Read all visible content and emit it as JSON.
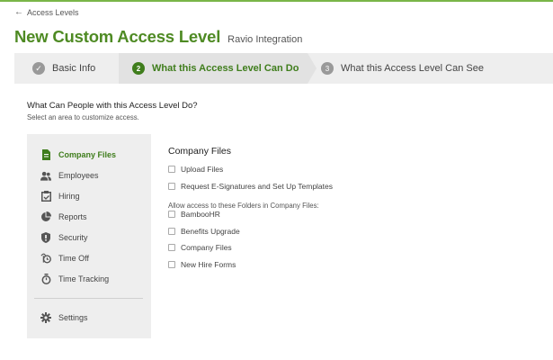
{
  "nav": {
    "back_label": "Access Levels"
  },
  "header": {
    "title": "New Custom Access Level",
    "subtitle": "Ravio Integration"
  },
  "steps": [
    {
      "number": "1",
      "label": "Basic Info",
      "state": "complete",
      "check": "✓"
    },
    {
      "number": "2",
      "label": "What this Access Level Can Do",
      "state": "active"
    },
    {
      "number": "3",
      "label": "What this Access Level Can See",
      "state": "upcoming"
    }
  ],
  "section": {
    "title": "What Can People with this Access Level Do?",
    "subtitle": "Select an area to customize access."
  },
  "sidebar": {
    "items": [
      {
        "label": "Company Files",
        "icon": "file-icon",
        "active": true
      },
      {
        "label": "Employees",
        "icon": "people-icon"
      },
      {
        "label": "Hiring",
        "icon": "clipboard-icon"
      },
      {
        "label": "Reports",
        "icon": "pie-chart-icon"
      },
      {
        "label": "Security",
        "icon": "shield-icon"
      },
      {
        "label": "Time Off",
        "icon": "time-off-icon"
      },
      {
        "label": "Time Tracking",
        "icon": "stopwatch-icon"
      }
    ],
    "settings": {
      "label": "Settings",
      "icon": "gear-icon"
    }
  },
  "panel": {
    "title": "Company Files",
    "options": [
      {
        "label": "Upload Files",
        "checked": false
      },
      {
        "label": "Request E-Signatures and Set Up Templates",
        "checked": false
      }
    ],
    "folders_label": "Allow access to these Folders in Company Files:",
    "folders": [
      {
        "label": "BambooHR",
        "checked": false
      },
      {
        "label": "Benefits Upgrade",
        "checked": false
      },
      {
        "label": "Company Files",
        "checked": false
      },
      {
        "label": "New Hire Forms",
        "checked": false
      }
    ]
  },
  "colors": {
    "brand_green": "#4e8a23",
    "accent": "#7ab648",
    "muted": "#999999"
  }
}
